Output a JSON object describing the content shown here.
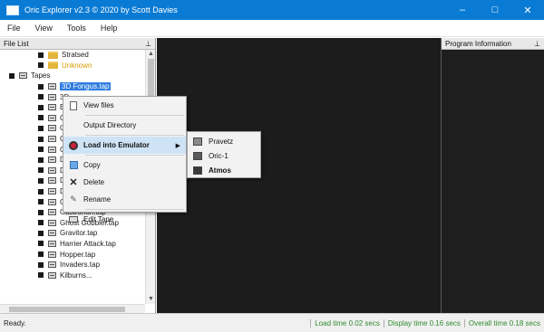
{
  "window": {
    "title": "Oric Explorer v2.3 © 2020 by Scott Davies",
    "buttons": {
      "minimize": "–",
      "maximize": "□",
      "close": "✕"
    }
  },
  "menu": [
    "File",
    "View",
    "Tools",
    "Help"
  ],
  "file_list": {
    "header": "File List",
    "pin": "⊥",
    "items": [
      {
        "label": "Stratsed",
        "kind": "folder",
        "indent": 2
      },
      {
        "label": "Unknown",
        "kind": "folder",
        "indent": 2
      },
      {
        "label": "Tapes",
        "kind": "tapes-root",
        "indent": 1
      },
      {
        "label": "3D Fongus.tap",
        "kind": "tape",
        "indent": 2,
        "selected": true
      },
      {
        "label": "3D",
        "kind": "tape",
        "indent": 2
      },
      {
        "label": "Ba",
        "kind": "tape",
        "indent": 2
      },
      {
        "label": "Cu",
        "kind": "tape",
        "indent": 2
      },
      {
        "label": "Ch",
        "kind": "tape",
        "indent": 2
      },
      {
        "label": "Co",
        "kind": "tape",
        "indent": 2
      },
      {
        "label": "Co",
        "kind": "tape",
        "indent": 2
      },
      {
        "label": "De",
        "kind": "tape",
        "indent": 2
      },
      {
        "label": "Do",
        "kind": "tape",
        "indent": 2
      },
      {
        "label": "Do",
        "kind": "tape",
        "indent": 2
      },
      {
        "label": "Dr",
        "kind": "tape",
        "indent": 2
      },
      {
        "label": "Galaxians.tap",
        "kind": "tape",
        "indent": 2
      },
      {
        "label": "Gastronon.tap",
        "kind": "tape",
        "indent": 2
      },
      {
        "label": "Ghost Gobbler.tap",
        "kind": "tape",
        "indent": 2
      },
      {
        "label": "Gravitor.tap",
        "kind": "tape",
        "indent": 2
      },
      {
        "label": "Harrier Attack.tap",
        "kind": "tape",
        "indent": 2
      },
      {
        "label": "Hopper.tap",
        "kind": "tape",
        "indent": 2
      },
      {
        "label": "Invaders.tap",
        "kind": "tape",
        "indent": 2
      },
      {
        "label": "Kilburns...",
        "kind": "tape",
        "indent": 2
      }
    ]
  },
  "program_info": {
    "header": "Program Information",
    "pin": "⊥"
  },
  "context_menu": {
    "items": [
      {
        "label": "View files",
        "icon": "document-icon"
      },
      {
        "label": "Output Directory",
        "icon": ""
      },
      {
        "label": "Load into Emulator",
        "icon": "emulator-icon",
        "bold": true,
        "submenu": true
      },
      {
        "label": "Copy",
        "icon": "copy-icon"
      },
      {
        "label": "Delete",
        "icon": "delete-icon"
      },
      {
        "label": "Rename",
        "icon": "rename-icon"
      },
      {
        "label": "Edit Tape",
        "icon": "edit-tape-icon"
      }
    ],
    "submenu": [
      {
        "label": "Pravetz",
        "color": "#8a8a8a"
      },
      {
        "label": "Oric-1",
        "color": "#5a5a5a"
      },
      {
        "label": "Atmos",
        "color": "#3a3a3a",
        "bold": true
      }
    ]
  },
  "status": {
    "text": "Ready.",
    "load_time": "Load time 0.02 secs",
    "display_time": "Display time 0.16 secs",
    "overall_time": "Overall time 0.18 secs"
  },
  "colors": {
    "titlebar": "#0a7bd4",
    "selection": "#2f7de0",
    "status_green": "#2e8b2e"
  }
}
